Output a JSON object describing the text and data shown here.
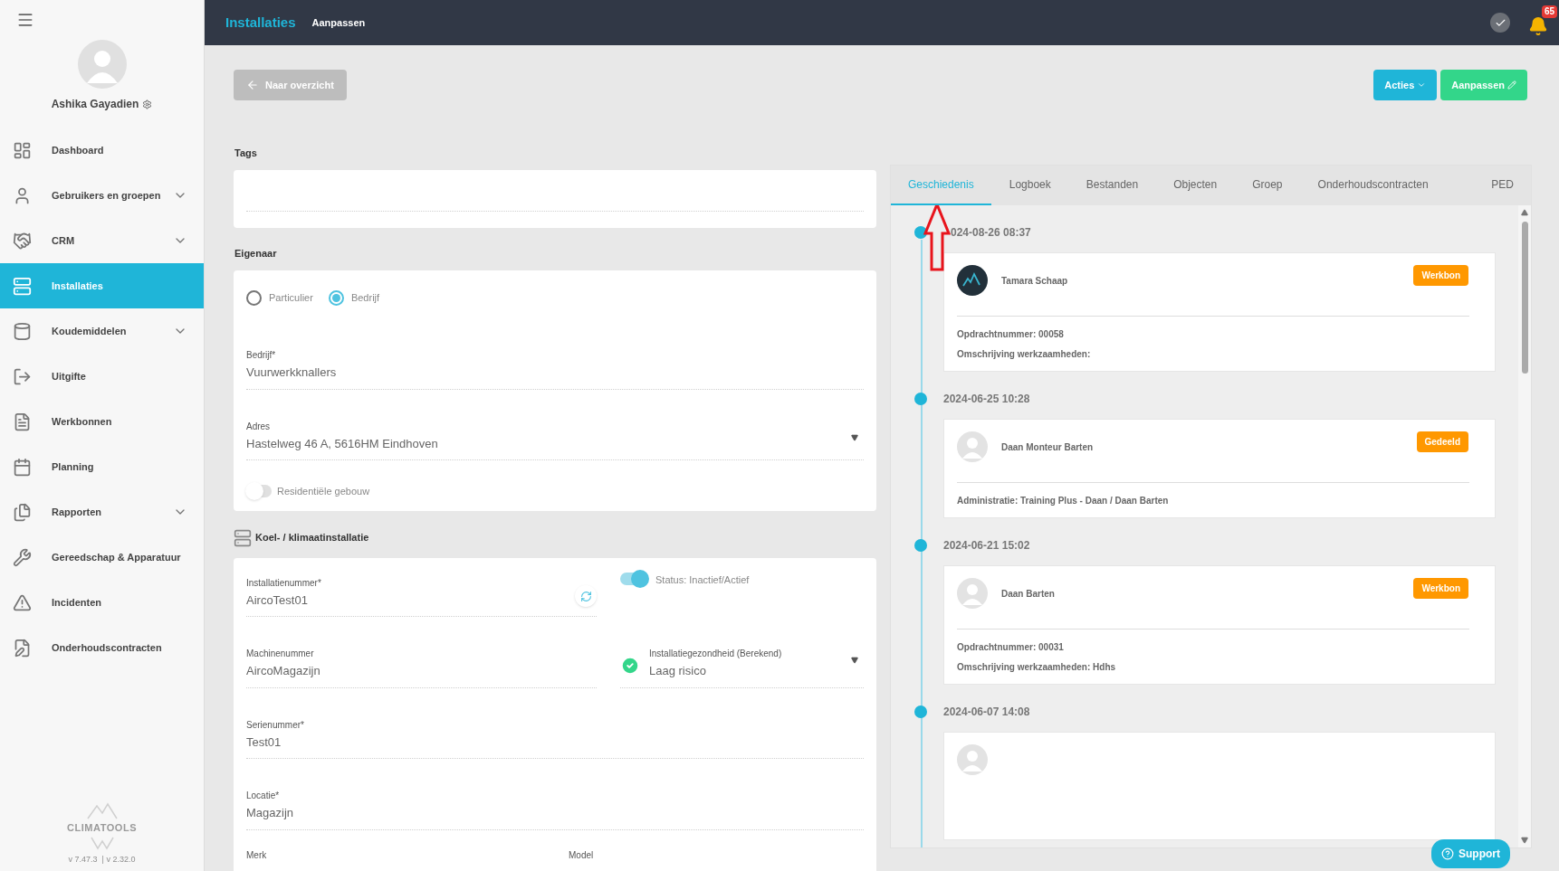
{
  "sidebar": {
    "user": "Ashika Gayadien",
    "brand": "CLIMATOOLS",
    "version": "v 7.47.3  | v 2.32.0",
    "items": [
      {
        "label": "Dashboard",
        "expandable": false,
        "selected": false
      },
      {
        "label": "Gebruikers en groepen",
        "expandable": true,
        "selected": false
      },
      {
        "label": "CRM",
        "expandable": true,
        "selected": false
      },
      {
        "label": "Installaties",
        "expandable": false,
        "selected": true
      },
      {
        "label": "Koudemiddelen",
        "expandable": true,
        "selected": false
      },
      {
        "label": "Uitgifte",
        "expandable": false,
        "selected": false
      },
      {
        "label": "Werkbonnen",
        "expandable": false,
        "selected": false
      },
      {
        "label": "Planning",
        "expandable": false,
        "selected": false
      },
      {
        "label": "Rapporten",
        "expandable": true,
        "selected": false
      },
      {
        "label": "Gereedschap & Apparatuur",
        "expandable": false,
        "selected": false
      },
      {
        "label": "Incidenten",
        "expandable": false,
        "selected": false
      },
      {
        "label": "Onderhoudscontracten",
        "expandable": false,
        "selected": false
      }
    ]
  },
  "topbar": {
    "title": "Installaties",
    "subtitle": "Aanpassen",
    "notifications": "65"
  },
  "toolbar": {
    "back": "Naar overzicht",
    "actions": "Acties",
    "edit": "Aanpassen"
  },
  "tags": {
    "label": "Tags"
  },
  "owner": {
    "label": "Eigenaar",
    "options": [
      {
        "label": "Particulier",
        "selected": false
      },
      {
        "label": "Bedrijf",
        "selected": true
      }
    ],
    "company": {
      "label": "Bedrijf*",
      "value": "Vuurwerkknallers"
    },
    "address": {
      "label": "Adres",
      "value": "Hastelweg 46 A, 5616HM Eindhoven"
    },
    "residential": {
      "label": "Residentiële gebouw",
      "on": false
    }
  },
  "installation": {
    "title": "Koel- / klimaatinstallatie",
    "number": {
      "label": "Installatienummer*",
      "value": "AircoTest01"
    },
    "status": {
      "label": "Status: Inactief/Actief",
      "on": true
    },
    "machine": {
      "label": "Machinenummer",
      "value": "AircoMagazijn"
    },
    "health": {
      "label": "Installatiegezondheid (Berekend)",
      "value": "Laag risico"
    },
    "serial": {
      "label": "Serienummer*",
      "value": "Test01"
    },
    "location": {
      "label": "Locatie*",
      "value": "Magazijn"
    },
    "brand_label": "Merk",
    "model_label": "Model"
  },
  "history": {
    "tabs": [
      {
        "label": "Geschiedenis",
        "selected": true
      },
      {
        "label": "Logboek",
        "selected": false
      },
      {
        "label": "Bestanden",
        "selected": false
      },
      {
        "label": "Objecten",
        "selected": false
      },
      {
        "label": "Groep",
        "selected": false
      },
      {
        "label": "Onderhoudscontracten",
        "selected": false
      },
      {
        "label": "PED",
        "selected": false
      }
    ],
    "entries": [
      {
        "date": "024-08-26 08:37",
        "user": "Tamara Schaap",
        "avatar": {
          "kind": "logo"
        },
        "badge": "Werkbon",
        "lines": [
          "Opdrachtnummer: 00058",
          "Omschrijving werkzaamheden:"
        ]
      },
      {
        "date": "2024-06-25 10:28",
        "user": "Daan Monteur Barten",
        "avatar": {
          "kind": "person"
        },
        "badge": "Gedeeld",
        "lines": [
          "Administratie: Training Plus - Daan / Daan Barten"
        ]
      },
      {
        "date": "2024-06-21 15:02",
        "user": "Daan Barten",
        "avatar": {
          "kind": "person"
        },
        "badge": "Werkbon",
        "lines": [
          "Opdrachtnummer: 00031",
          "Omschrijving werkzaamheden: Hdhs"
        ]
      },
      {
        "date": "2024-06-07 14:08",
        "avatar": {
          "kind": "person"
        }
      }
    ]
  },
  "support": "Support"
}
